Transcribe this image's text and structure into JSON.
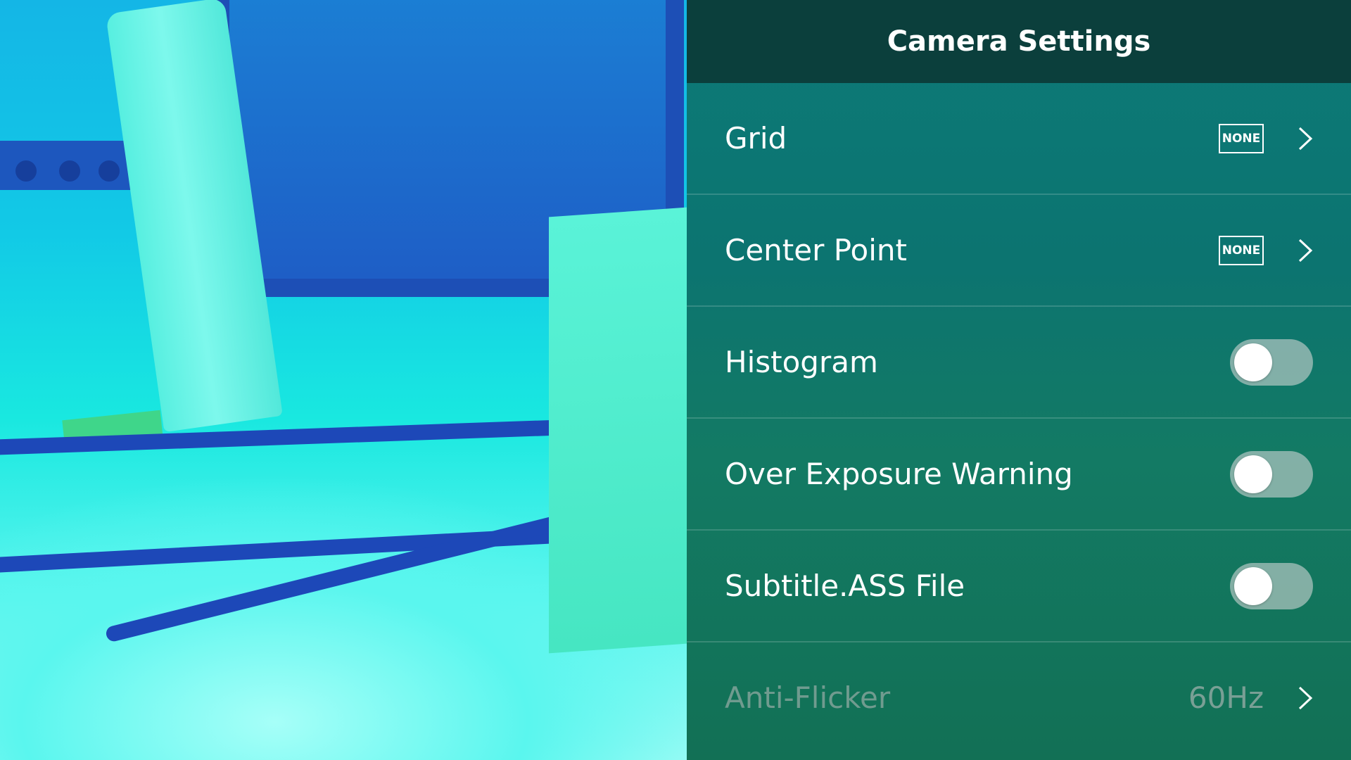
{
  "header": {
    "title": "Camera Settings"
  },
  "settings": [
    {
      "label": "Grid",
      "kind": "badge",
      "badge": "NONE",
      "icon": "chevron-right-icon"
    },
    {
      "label": "Center Point",
      "kind": "badge",
      "badge": "NONE",
      "icon": "chevron-right-icon"
    },
    {
      "label": "Histogram",
      "kind": "toggle",
      "on": false
    },
    {
      "label": "Over Exposure Warning",
      "kind": "toggle",
      "on": false
    },
    {
      "label": "Subtitle.ASS File",
      "kind": "toggle",
      "on": false
    },
    {
      "label": "Anti-Flicker",
      "kind": "value",
      "value": "60Hz",
      "disabled": true,
      "icon": "chevron-right-icon"
    }
  ],
  "colors": {
    "header_bg": "#0b3f3c",
    "panel_bg": "#0d7a78",
    "text": "#ffffff",
    "disabled_text": "#bebebe",
    "toggle_off_track": "#b4c8c3"
  }
}
